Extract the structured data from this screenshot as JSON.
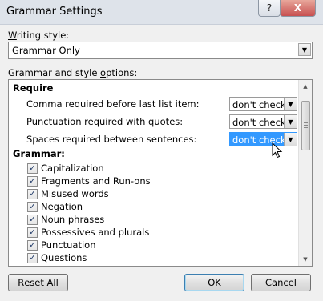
{
  "window": {
    "title": "Grammar Settings",
    "help_glyph": "?",
    "close_glyph": "X"
  },
  "writing_style": {
    "label_first": "W",
    "label_rest": "riting style:",
    "value": "Grammar Only"
  },
  "options": {
    "label_prefix": "Grammar and style ",
    "label_u": "o",
    "label_rest": "ptions:",
    "require_heading": "Require",
    "require_items": [
      {
        "label": "Comma required before last list item:",
        "value": "don't check"
      },
      {
        "label": "Punctuation required with quotes:",
        "value": "don't check"
      },
      {
        "label": "Spaces required between sentences:",
        "value": "don't check"
      }
    ],
    "grammar_heading": "Grammar:",
    "grammar_items": [
      {
        "label": "Capitalization",
        "checked": true
      },
      {
        "label": "Fragments and Run-ons",
        "checked": true
      },
      {
        "label": "Misused words",
        "checked": true
      },
      {
        "label": "Negation",
        "checked": true
      },
      {
        "label": "Noun phrases",
        "checked": true
      },
      {
        "label": "Possessives and plurals",
        "checked": true
      },
      {
        "label": "Punctuation",
        "checked": true
      },
      {
        "label": "Questions",
        "checked": true
      }
    ]
  },
  "buttons": {
    "reset_first": "R",
    "reset_rest": "eset All",
    "ok": "OK",
    "cancel": "Cancel"
  },
  "colors": {
    "selection": "#3399ff",
    "dialog_bg": "#f0f0f0",
    "close_button": "#c75050"
  }
}
